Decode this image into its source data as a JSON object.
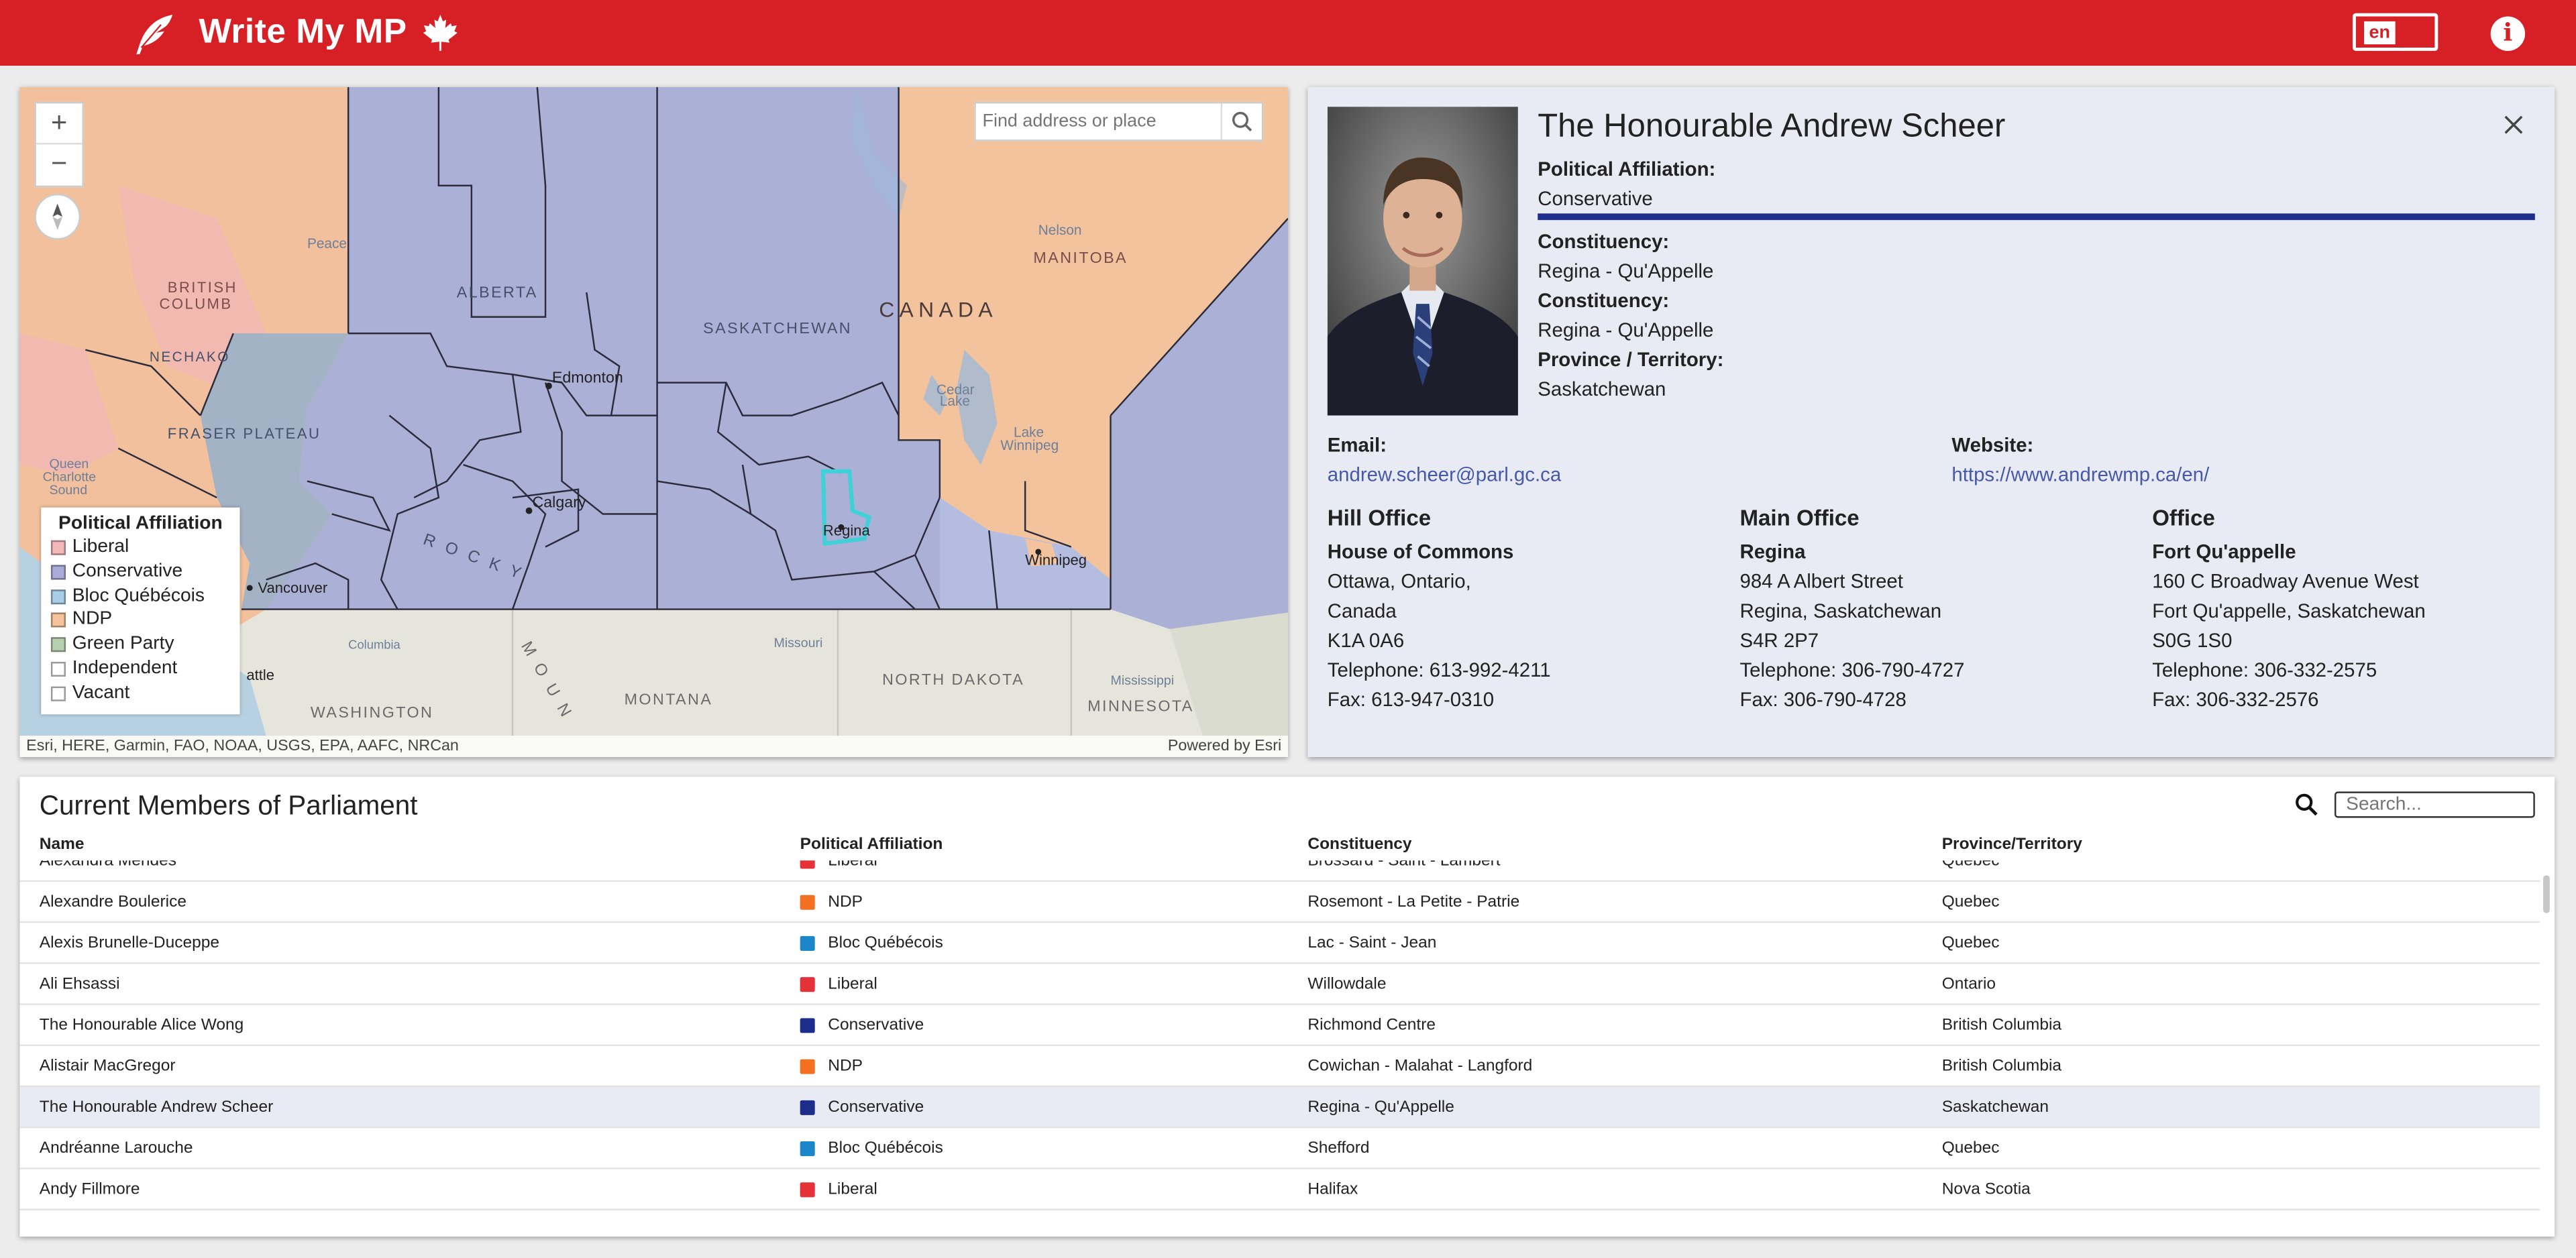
{
  "header": {
    "title": "Write My MP",
    "lang": "en"
  },
  "map": {
    "search_placeholder": "Find address or place",
    "labels": {
      "canada": "CANADA",
      "alberta": "ALBERTA",
      "saskatchewan": "SASKATCHEWAN",
      "manitoba": "MANITOBA",
      "british_columbia_1": "BRITISH",
      "british_columbia_2": "COLUMB",
      "edmonton": "Edmonton",
      "calgary": "Calgary",
      "regina": "Regina",
      "winnipeg": "Winnipeg",
      "vancouver": "Vancouver",
      "seattle": "attle",
      "washington": "WASHINGTON",
      "montana": "MONTANA",
      "north_dakota": "NORTH DAKOTA",
      "minnesota": "MINNESOTA",
      "fraser_plateau": "FRASER PLATEAU",
      "nechako": "NECHAKO",
      "cedar_lake_1": "Cedar",
      "cedar_lake_2": "Lake",
      "lake_winnipeg_1": "Lake",
      "lake_winnipeg_2": "Winnipeg",
      "nelson": "Nelson",
      "peace": "Peace",
      "missouri": "Missouri",
      "mississippi": "Mississippi",
      "queen_charlotte_1": "Queen",
      "queen_charlotte_2": "Charlotte",
      "queen_charlotte_3": "Sound",
      "rocky": "R O C K Y",
      "moun": "M O U N",
      "columbia": "Columbia"
    },
    "legend": {
      "title": "Political Affiliation",
      "items": [
        {
          "label": "Liberal",
          "color": "#f4b8bb"
        },
        {
          "label": "Conservative",
          "color": "#a9acd9"
        },
        {
          "label": "Bloc Québécois",
          "color": "#a8cde8"
        },
        {
          "label": "NDP",
          "color": "#f6c39c"
        },
        {
          "label": "Green Party",
          "color": "#b7d1b0"
        },
        {
          "label": "Independent",
          "color": "#ffffff"
        },
        {
          "label": "Vacant",
          "color": "#ffffff"
        }
      ]
    },
    "attribution_left": "Esri, HERE, Garmin, FAO, NOAA, USGS, EPA, AAFC, NRCan",
    "attribution_right": "Powered by Esri"
  },
  "mp": {
    "name": "The Honourable Andrew Scheer",
    "affiliation_label": "Political Affiliation:",
    "affiliation": "Conservative",
    "party_color": "#1c2d8c",
    "constituency_label": "Constituency:",
    "constituency": "Regina - Qu'Appelle",
    "constituency_label_2": "Constituency:",
    "constituency_2": "Regina - Qu'Appelle",
    "province_label": "Province / Territory:",
    "province": "Saskatchewan",
    "email_label": "Email:",
    "email": "andrew.scheer@parl.gc.ca",
    "website_label": "Website:",
    "website": "https://www.andrewmp.ca/en/",
    "offices": [
      {
        "heading": "Hill Office",
        "name": "House of Commons",
        "lines": [
          "Ottawa, Ontario,",
          "Canada",
          "K1A 0A6",
          "Telephone: 613-992-4211",
          "Fax: 613-947-0310"
        ]
      },
      {
        "heading": "Main Office",
        "name": "Regina",
        "lines": [
          "984 A Albert Street",
          "Regina, Saskatchewan",
          "S4R 2P7",
          "Telephone: 306-790-4727",
          "Fax: 306-790-4728"
        ]
      },
      {
        "heading": "Office",
        "name": "Fort Qu'appelle",
        "lines": [
          "160 C Broadway Avenue West",
          "Fort Qu'appelle, Saskatchewan",
          "S0G 1S0",
          "Telephone: 306-332-2575",
          "Fax: 306-332-2576"
        ]
      }
    ]
  },
  "table": {
    "title": "Current Members of Parliament",
    "search_placeholder": "Search...",
    "columns": [
      "Name",
      "Political Affiliation",
      "Constituency",
      "Province/Territory"
    ],
    "rows": [
      {
        "name": "Alexandra Mendes",
        "party": "Liberal",
        "color": "#e53238",
        "constituency": "Brossard - Saint - Lambert",
        "province": "Quebec"
      },
      {
        "name": "Alexandre Boulerice",
        "party": "NDP",
        "color": "#f37021",
        "constituency": "Rosemont - La Petite - Patrie",
        "province": "Quebec"
      },
      {
        "name": "Alexis Brunelle-Duceppe",
        "party": "Bloc Québécois",
        "color": "#1b86c9",
        "constituency": "Lac - Saint - Jean",
        "province": "Quebec"
      },
      {
        "name": "Ali Ehsassi",
        "party": "Liberal",
        "color": "#e53238",
        "constituency": "Willowdale",
        "province": "Ontario"
      },
      {
        "name": "The Honourable Alice Wong",
        "party": "Conservative",
        "color": "#1c2d8c",
        "constituency": "Richmond Centre",
        "province": "British Columbia"
      },
      {
        "name": "Alistair MacGregor",
        "party": "NDP",
        "color": "#f37021",
        "constituency": "Cowichan - Malahat - Langford",
        "province": "British Columbia"
      },
      {
        "name": "The Honourable Andrew Scheer",
        "party": "Conservative",
        "color": "#1c2d8c",
        "constituency": "Regina - Qu'Appelle",
        "province": "Saskatchewan"
      },
      {
        "name": "Andréanne Larouche",
        "party": "Bloc Québécois",
        "color": "#1b86c9",
        "constituency": "Shefford",
        "province": "Quebec"
      },
      {
        "name": "Andy Fillmore",
        "party": "Liberal",
        "color": "#e53238",
        "constituency": "Halifax",
        "province": "Nova Scotia"
      }
    ],
    "selected_index": 6
  }
}
